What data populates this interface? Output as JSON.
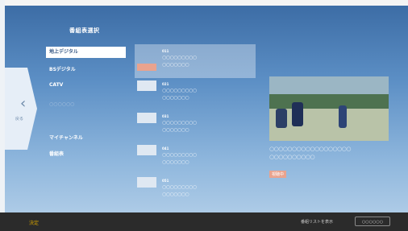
{
  "colors": {
    "accent": "#e9a38e",
    "selected_bg": "#ffffff",
    "bottom_bar": "#2b2b2b"
  },
  "header": {
    "title": "番組表選択"
  },
  "back": {
    "label": "戻る",
    "icon": "chevron-left-icon"
  },
  "menu": [
    {
      "label": "地上デジタル",
      "selected": true
    },
    {
      "label": "BSデジタル"
    },
    {
      "label": "CATV"
    },
    {
      "label": "○○○○○○"
    },
    {
      "label": "マイチャンネル"
    },
    {
      "label": "番組表"
    }
  ],
  "channels": [
    {
      "number": "011",
      "line1": "○○○○○○○○○",
      "line2": "○○○○○○○"
    },
    {
      "number": "021",
      "line1": "○○○○○○○○○",
      "line2": "○○○○○○○"
    },
    {
      "number": "031",
      "line1": "○○○○○○○○○",
      "line2": "○○○○○○○"
    },
    {
      "number": "041",
      "line1": "○○○○○○○○○",
      "line2": "○○○○○○○"
    },
    {
      "number": "051",
      "line1": "○○○○○○○○○",
      "line2": "○○○○○○○"
    }
  ],
  "program": {
    "text": "○○○○○○○○○○○○○○○○○○ ○○○○○○○○○○",
    "badge": "視聴中"
  },
  "bottom": {
    "left_label": "決定",
    "hint": "番組リストを表示",
    "key_label": "○○○○○○"
  }
}
